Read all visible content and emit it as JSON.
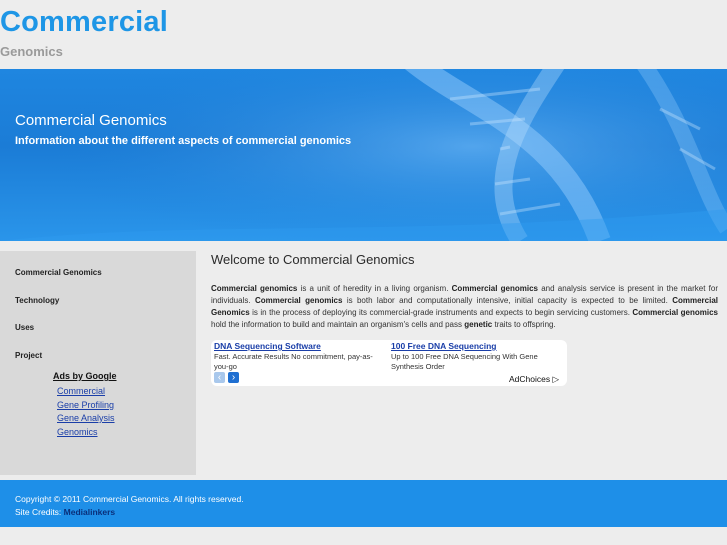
{
  "header": {
    "logo_title": "Commercial",
    "logo_subtitle": "Genomics"
  },
  "banner": {
    "title": "Commercial Genomics",
    "subtitle": "Information about the different aspects of commercial genomics",
    "image": "dna-helix"
  },
  "sidebar": {
    "nav": [
      "Commercial Genomics",
      "Technology",
      "Uses",
      "Project"
    ],
    "ads_heading": "Ads by Google",
    "ad_links": [
      "Commercial",
      "Gene Profiling",
      "Gene Analysis",
      "Genomics"
    ]
  },
  "main": {
    "title": "Welcome to Commercial Genomics",
    "paragraph": [
      {
        "b": "Commercial genomics"
      },
      {
        "t": " is a unit of heredity in a living organism. "
      },
      {
        "b": "Commercial genomics"
      },
      {
        "t": " and analysis service is present in the market for individuals. "
      },
      {
        "b": "Commercial genomics"
      },
      {
        "t": " is both labor and computationally intensive, initial capacity is expected to be limited. "
      },
      {
        "b": "Commercial Genomics"
      },
      {
        "t": " is in the process of deploying its commercial-grade instruments and expects to begin servicing customers. "
      },
      {
        "b": "Commercial genomics"
      },
      {
        "t": " hold the information to build and maintain an organism's cells and pass "
      },
      {
        "b": "genetic"
      },
      {
        "t": " traits to offspring."
      }
    ]
  },
  "adbox": {
    "ads": [
      {
        "title": "DNA Sequencing Software",
        "desc1": "Fast. Accurate Results No commitment, pay-as-",
        "desc2": "you-go"
      },
      {
        "title": "100 Free DNA Sequencing",
        "desc1": "Up to 100 Free DNA Sequencing With Gene",
        "desc2": "Synthesis Order"
      }
    ],
    "prev_icon": "‹",
    "next_icon": "›",
    "adchoices_label": "AdChoices",
    "adchoices_icon": "▷"
  },
  "footer": {
    "copyright": "Copyright © 2011 Commercial Genomics. All rights reserved.",
    "credits_label": "Site Credits: ",
    "credits_link": "Medialinkers"
  },
  "colors": {
    "brand": "#1e96e6",
    "banner": "#1b7cd6",
    "footer": "#1e8fe8",
    "link": "#1a3ea8"
  }
}
